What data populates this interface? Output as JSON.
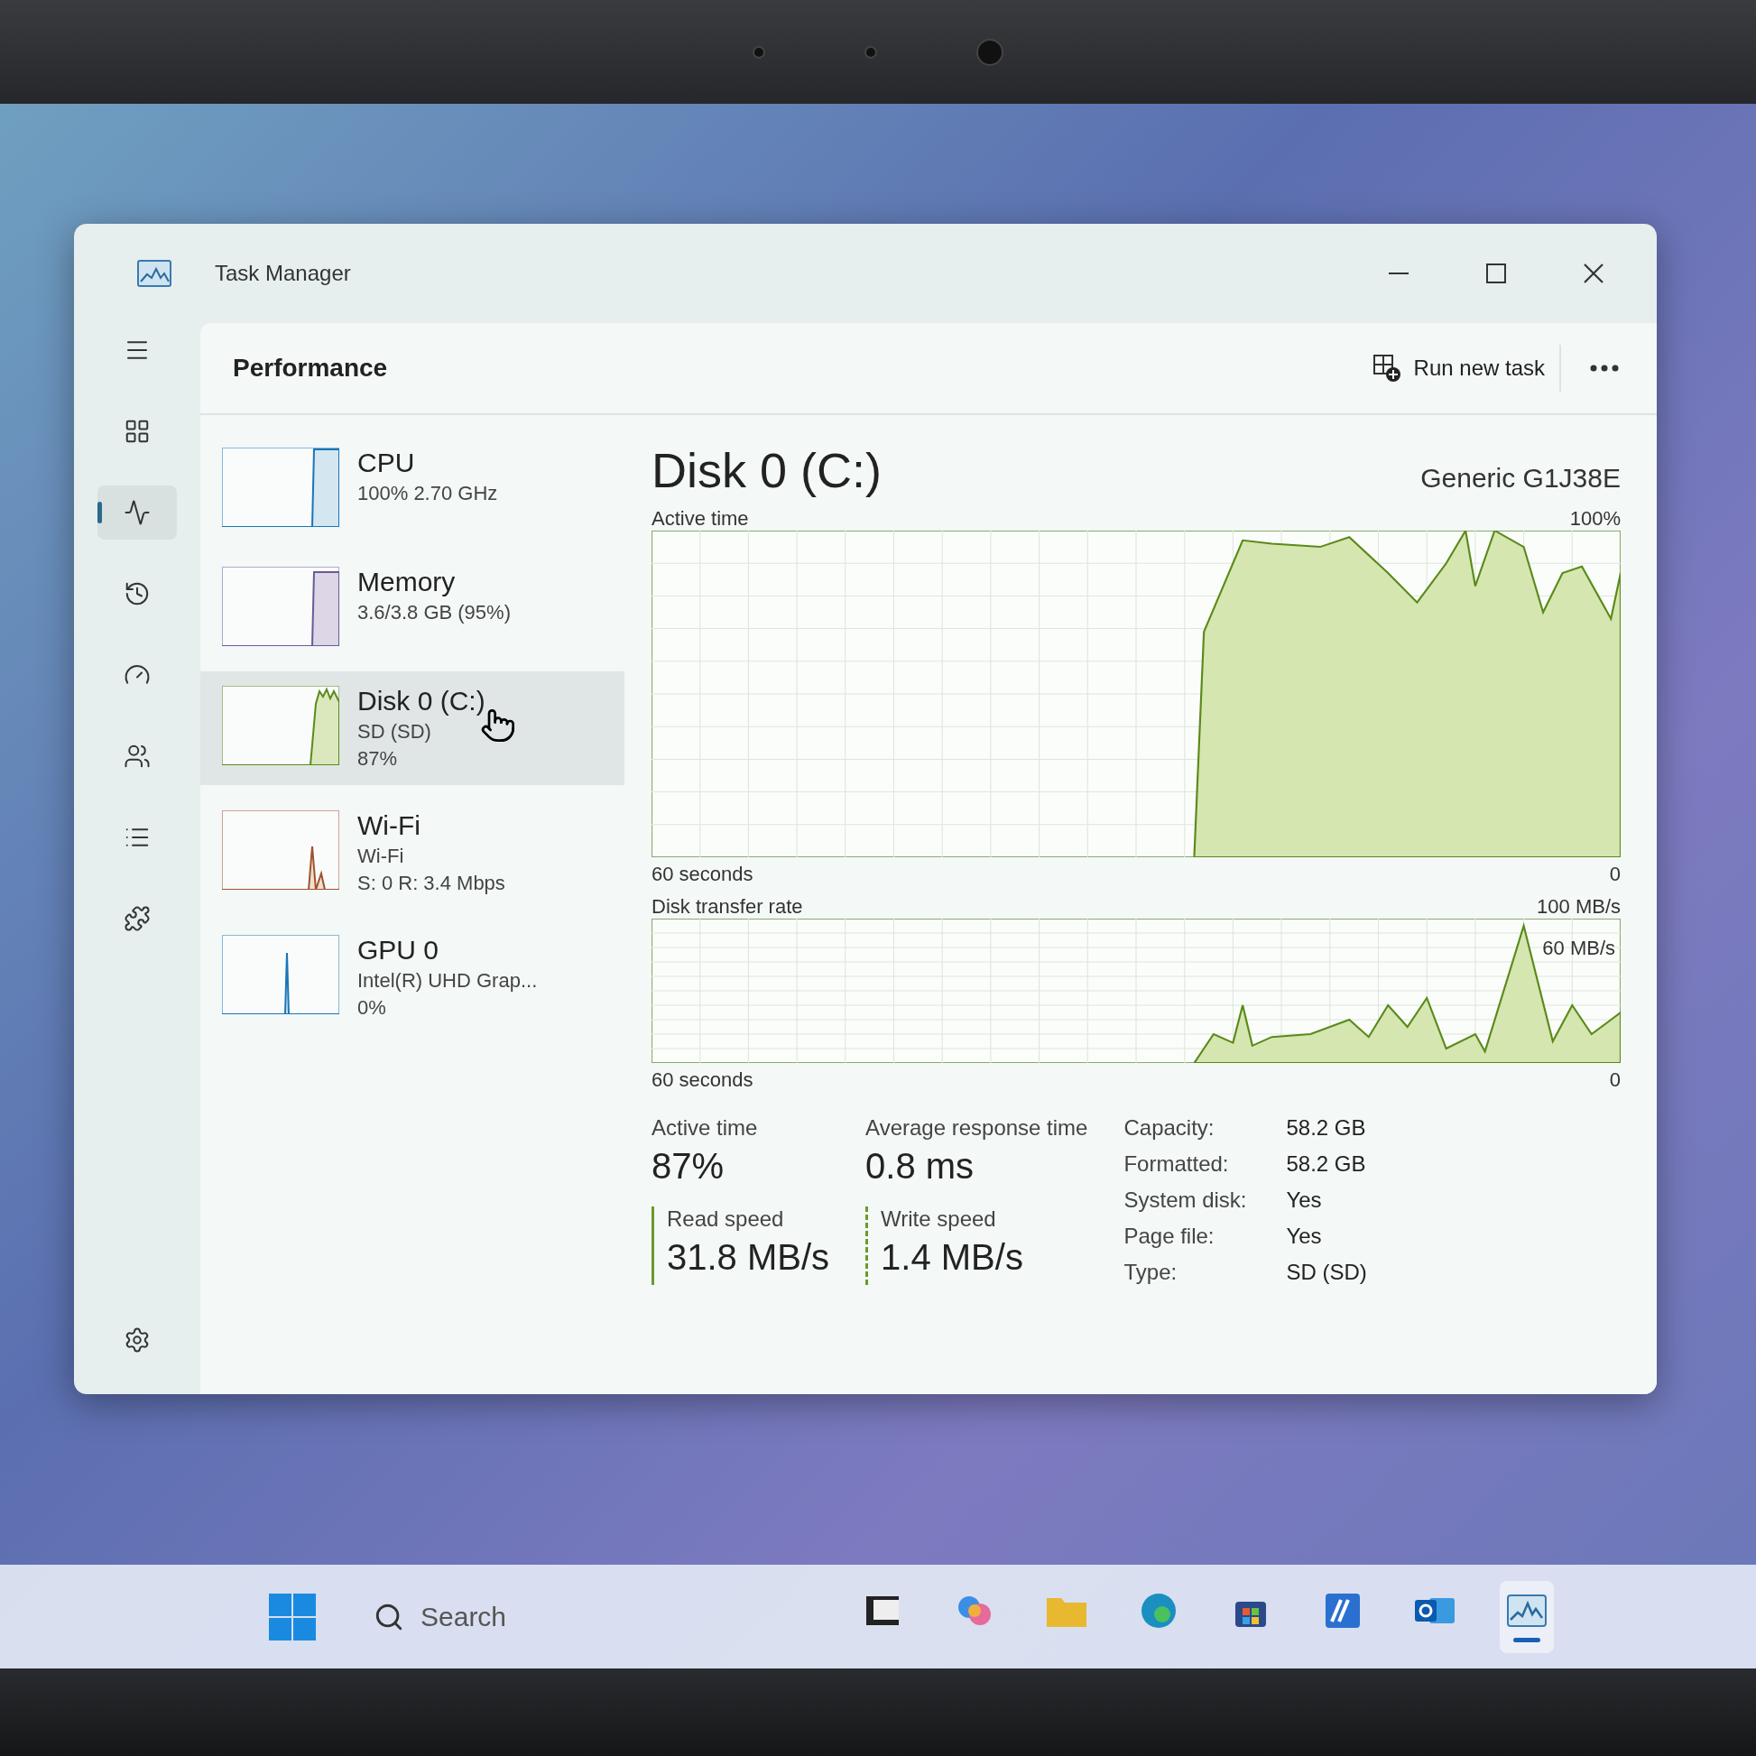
{
  "window": {
    "title": "Task Manager"
  },
  "nav": [
    {
      "kind": "menu",
      "selected": false
    },
    {
      "kind": "processes",
      "selected": false
    },
    {
      "kind": "performance",
      "selected": true
    },
    {
      "kind": "history",
      "selected": false
    },
    {
      "kind": "startup",
      "selected": false
    },
    {
      "kind": "users",
      "selected": false
    },
    {
      "kind": "details",
      "selected": false
    },
    {
      "kind": "services",
      "selected": false
    }
  ],
  "nav_settings": {
    "kind": "settings",
    "selected": false
  },
  "header": {
    "title": "Performance",
    "run_new_task": "Run new task"
  },
  "devices": [
    {
      "kind": "cpu",
      "name": "CPU",
      "lines": [
        "100% 2.70 GHz"
      ],
      "selected": false
    },
    {
      "kind": "memory",
      "name": "Memory",
      "lines": [
        "3.6/3.8 GB (95%)"
      ],
      "selected": false
    },
    {
      "kind": "disk",
      "name": "Disk 0 (C:)",
      "lines": [
        "SD (SD)",
        "87%"
      ],
      "selected": true
    },
    {
      "kind": "network",
      "name": "Wi-Fi",
      "lines": [
        "Wi-Fi",
        "S: 0 R: 3.4 Mbps"
      ],
      "selected": false
    },
    {
      "kind": "gpu",
      "name": "GPU 0",
      "lines": [
        "Intel(R) UHD Grap...",
        "0%"
      ],
      "selected": false
    }
  ],
  "detail": {
    "title": "Disk 0 (C:)",
    "model": "Generic G1J38E",
    "active_chart": {
      "label": "Active time",
      "max": "100%",
      "span": "60 seconds",
      "min": "0"
    },
    "transfer_chart": {
      "label": "Disk transfer rate",
      "max": "100 MB/s",
      "mark": "60 MB/s",
      "span": "60 seconds",
      "min": "0"
    },
    "stats": [
      {
        "label": "Active time",
        "value": "87%"
      },
      {
        "label": "Average response time",
        "value": "0.8 ms"
      }
    ],
    "speeds": [
      {
        "kind": "read",
        "label": "Read speed",
        "value": "31.8 MB/s"
      },
      {
        "kind": "write",
        "label": "Write speed",
        "value": "1.4 MB/s"
      }
    ],
    "properties": [
      {
        "key": "Capacity:",
        "value": "58.2 GB"
      },
      {
        "key": "Formatted:",
        "value": "58.2 GB"
      },
      {
        "key": "System disk:",
        "value": "Yes"
      },
      {
        "key": "Page file:",
        "value": "Yes"
      },
      {
        "key": "Type:",
        "value": "SD (SD)"
      }
    ]
  },
  "taskbar": {
    "search": {
      "placeholder": "Search"
    },
    "apps": [
      {
        "kind": "terminal",
        "selected": false
      },
      {
        "kind": "copilot",
        "selected": false
      },
      {
        "kind": "folder",
        "selected": false
      },
      {
        "kind": "edge",
        "selected": false
      },
      {
        "kind": "store",
        "selected": false
      },
      {
        "kind": "app",
        "selected": false
      },
      {
        "kind": "outlook",
        "selected": false
      },
      {
        "kind": "taskmanager",
        "selected": true
      }
    ]
  }
}
